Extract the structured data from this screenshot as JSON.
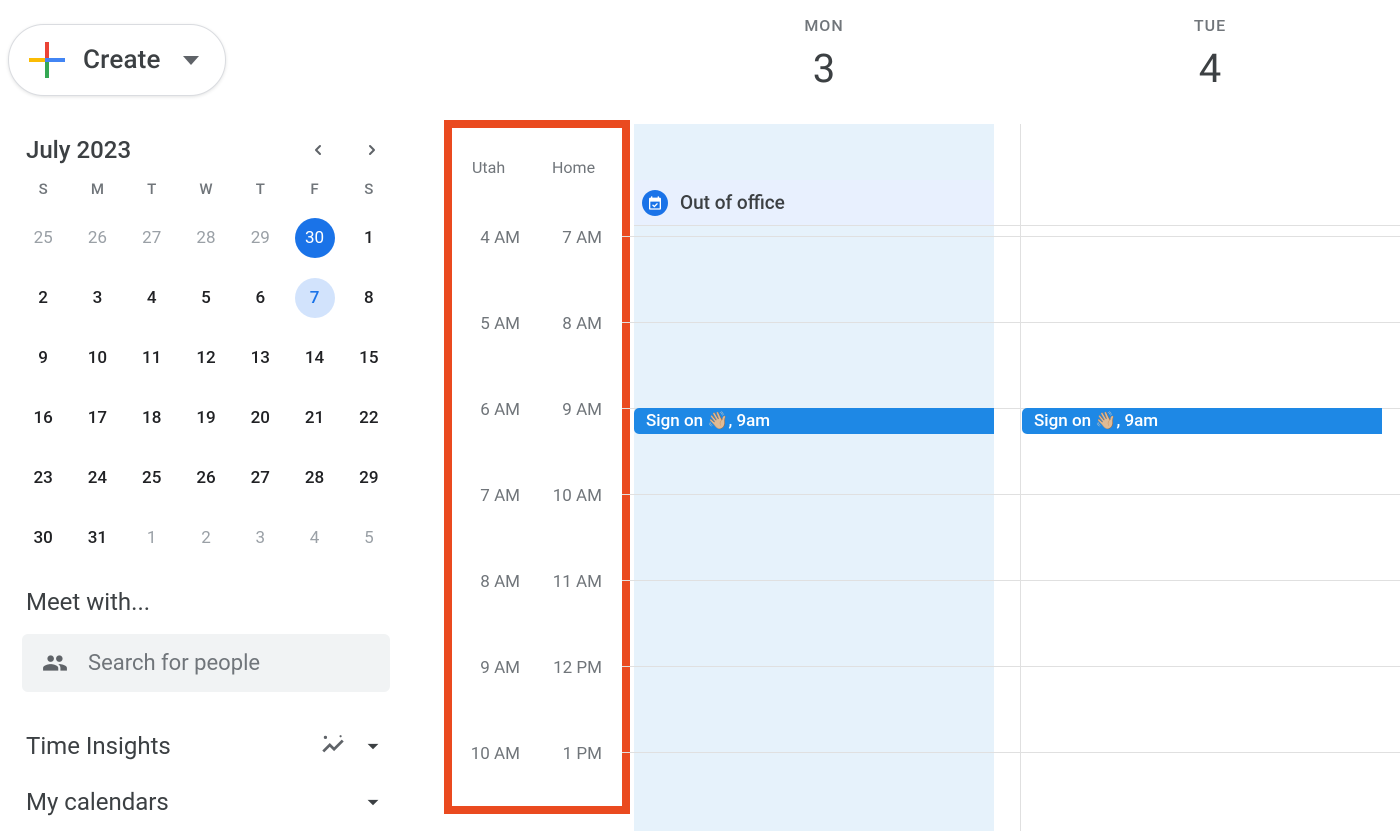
{
  "create_button": {
    "label": "Create"
  },
  "mini_calendar": {
    "title": "July 2023",
    "dow": [
      "S",
      "M",
      "T",
      "W",
      "T",
      "F",
      "S"
    ],
    "weeks": [
      [
        {
          "d": "25",
          "other": true
        },
        {
          "d": "26",
          "other": true
        },
        {
          "d": "27",
          "other": true
        },
        {
          "d": "28",
          "other": true
        },
        {
          "d": "29",
          "other": true
        },
        {
          "d": "30",
          "other": true,
          "sel_primary": true
        },
        {
          "d": "1"
        }
      ],
      [
        {
          "d": "2"
        },
        {
          "d": "3"
        },
        {
          "d": "4"
        },
        {
          "d": "5"
        },
        {
          "d": "6"
        },
        {
          "d": "7",
          "sel_secondary": true
        },
        {
          "d": "8"
        }
      ],
      [
        {
          "d": "9"
        },
        {
          "d": "10"
        },
        {
          "d": "11"
        },
        {
          "d": "12"
        },
        {
          "d": "13"
        },
        {
          "d": "14"
        },
        {
          "d": "15"
        }
      ],
      [
        {
          "d": "16"
        },
        {
          "d": "17"
        },
        {
          "d": "18"
        },
        {
          "d": "19"
        },
        {
          "d": "20"
        },
        {
          "d": "21"
        },
        {
          "d": "22"
        }
      ],
      [
        {
          "d": "23"
        },
        {
          "d": "24"
        },
        {
          "d": "25"
        },
        {
          "d": "26"
        },
        {
          "d": "27"
        },
        {
          "d": "28"
        },
        {
          "d": "29"
        }
      ],
      [
        {
          "d": "30"
        },
        {
          "d": "31"
        },
        {
          "d": "1",
          "other": true
        },
        {
          "d": "2",
          "other": true
        },
        {
          "d": "3",
          "other": true
        },
        {
          "d": "4",
          "other": true
        },
        {
          "d": "5",
          "other": true
        }
      ]
    ]
  },
  "meet_with": {
    "label": "Meet with...",
    "search_placeholder": "Search for people"
  },
  "time_insights_label": "Time Insights",
  "my_calendars_label": "My calendars",
  "week": {
    "days": [
      {
        "dow": "MON",
        "num": "3"
      },
      {
        "dow": "TUE",
        "num": "4"
      }
    ],
    "timezones": {
      "left": "Utah",
      "right": "Home"
    },
    "hours": [
      {
        "utah": "4 AM",
        "home": "7 AM"
      },
      {
        "utah": "5 AM",
        "home": "8 AM"
      },
      {
        "utah": "6 AM",
        "home": "9 AM"
      },
      {
        "utah": "7 AM",
        "home": "10 AM"
      },
      {
        "utah": "8 AM",
        "home": "11 AM"
      },
      {
        "utah": "9 AM",
        "home": "12 PM"
      },
      {
        "utah": "10 AM",
        "home": "1 PM"
      }
    ],
    "ooo_label": "Out of office",
    "events": {
      "mon": "Sign on 👋🏼, 9am",
      "tue": "Sign on 👋🏼, 9am"
    }
  }
}
